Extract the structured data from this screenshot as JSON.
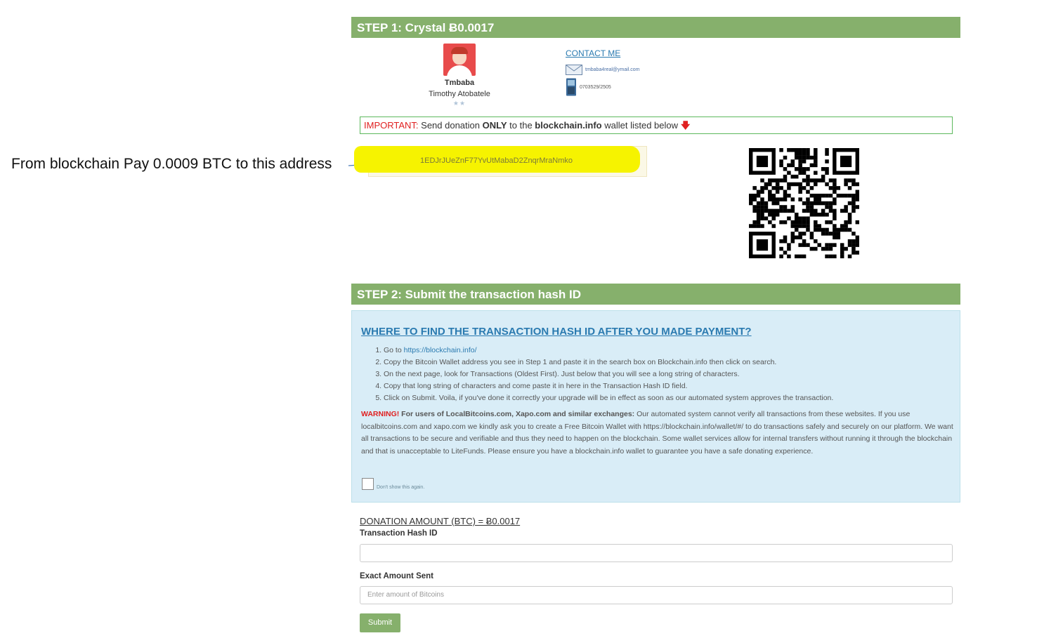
{
  "annotation": {
    "text": "From blockchain Pay 0.0009 BTC to this address"
  },
  "step1": {
    "title": "STEP 1: Crystal Ƀ0.0017"
  },
  "profile": {
    "username": "Tmbaba",
    "fullname": "Timothy Atobatele",
    "stars": "★★"
  },
  "contact": {
    "title": "CONTACT ME",
    "email": "tmbaba4real@ymail.com",
    "phone": "0703529/2505"
  },
  "important": {
    "label": "IMPORTANT:",
    "pre": " Send donation ",
    "only": "ONLY",
    "mid": " to the ",
    "site": "blockchain.info",
    "post": " wallet listed below",
    "arrow": "🡇"
  },
  "wallet": {
    "address": "1EDJrJUeZnF77YvUtMabaD2ZnqrMraNmko"
  },
  "step2": {
    "title": "STEP 2: Submit the transaction hash ID"
  },
  "info": {
    "title": "WHERE TO FIND THE TRANSACTION HASH ID AFTER YOU MADE PAYMENT?",
    "step1_pre": "Go to ",
    "step1_link": "https://blockchain.info/",
    "step2": "Copy the Bitcoin Wallet address you see in Step 1 and paste it in the search box on Blockchain.info then click on search.",
    "step3": "On the next page, look for Transactions (Oldest First). Just below that you will see a long string of characters.",
    "step4": "Copy that long string of characters and come paste it in here in the Transaction Hash ID field.",
    "step5": "Click on Submit. Voila, if you've done it correctly your upgrade will be in effect as soon as our automated system approves the transaction.",
    "warning_label": "WARNING!",
    "warning_bold": " For users of LocalBitcoins.com, Xapo.com and similar exchanges:",
    "warning_text": " Our automated system cannot verify all transactions from these websites. If you use localbitcoins.com and xapo.com we kindly ask you to create a Free Bitcoin Wallet with https://blockchain.info/wallet/#/ to do transactions safely and securely on our platform. We want all transactions to be secure and verifiable and thus they need to happen on the blockchain. Some wallet services allow for internal transfers without running it through the blockchain and that is unacceptable to LiteFunds. Please ensure you have a blockchain.info wallet to guarantee you have a safe donating experience.",
    "dont_show": "Don't show this again."
  },
  "form": {
    "donation_amount": "DONATION AMOUNT (BTC) = Ƀ0.0017",
    "hash_label": "Transaction Hash ID",
    "hash_value": "",
    "amount_label": "Exact Amount Sent",
    "amount_placeholder": "Enter amount of Bitcoins",
    "submit": "Submit"
  },
  "colors": {
    "header_green": "#86b06c",
    "info_blue": "#d9edf7",
    "highlight_yellow": "#f6f300",
    "warning_red": "#e02020"
  }
}
